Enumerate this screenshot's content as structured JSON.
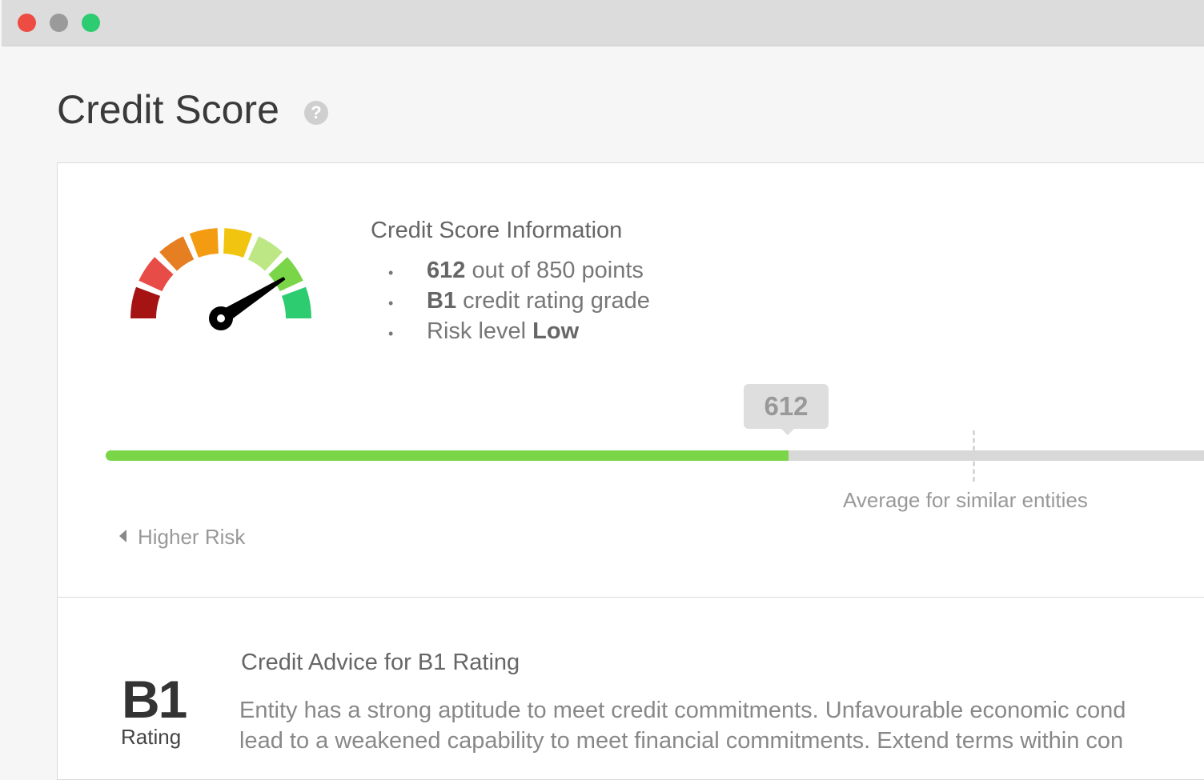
{
  "window": {
    "controls": {
      "close_color": "#ec4c41",
      "minimize_color": "#9a9a9a",
      "maximize_color": "#2ecc71"
    }
  },
  "page": {
    "title": "Credit Score",
    "help_icon": "?"
  },
  "gauge": {
    "segment_colors": [
      "#a51313",
      "#e84c47",
      "#e67e22",
      "#f39c12",
      "#f1c40f",
      "#bce784",
      "#7ad648",
      "#2ecc71"
    ],
    "value": 612,
    "max": 850
  },
  "info": {
    "title": "Credit Score Information",
    "items": [
      {
        "bold": "612",
        "text": " out of 850 points"
      },
      {
        "bold": "B1",
        "text": " credit rating grade"
      },
      {
        "text": "Risk level ",
        "bold": "Low"
      }
    ]
  },
  "score_bar": {
    "value": "612",
    "progress_percent": 64,
    "fill_color": "#7ad648",
    "average_label": "Average for similar entities",
    "higher_risk_label": "Higher Risk"
  },
  "advice": {
    "rating": "B1",
    "rating_label": "Rating",
    "title": "Credit Advice for B1 Rating",
    "line1": "Entity has a strong aptitude to meet credit commitments. Unfavourable economic cond",
    "line2": "lead to a weakened capability to meet financial commitments. Extend terms within con"
  }
}
